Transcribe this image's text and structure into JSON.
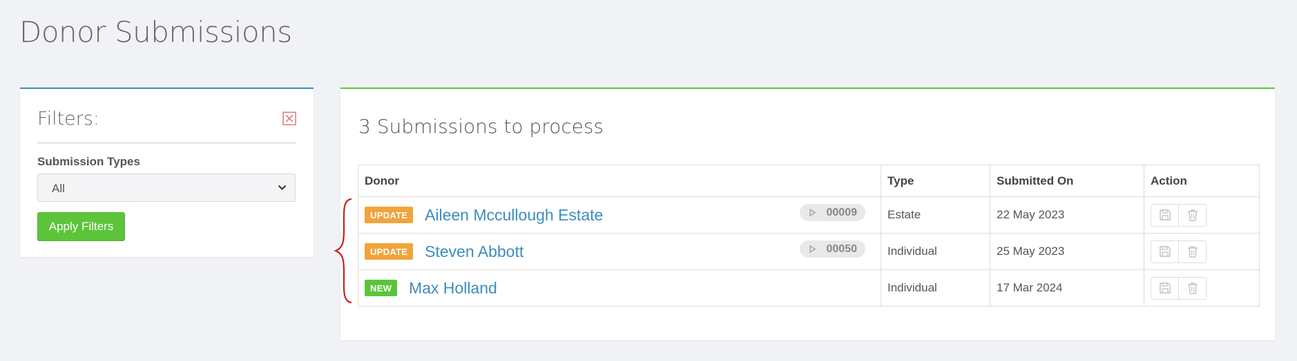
{
  "page": {
    "title": "Donor Submissions"
  },
  "filters": {
    "title": "Filters:",
    "close_icon": "close-icon",
    "submission_types_label": "Submission Types",
    "submission_types_value": "All",
    "apply_label": "Apply Filters"
  },
  "submissions": {
    "heading": "3 Submissions to process",
    "columns": [
      "Donor",
      "Type",
      "Submitted On",
      "Action"
    ],
    "rows": [
      {
        "badge": "UPDATE",
        "badge_color": "#f0a43b",
        "donor": "Aileen Mccullough Estate",
        "donor_id": "00009",
        "type": "Estate",
        "submitted_on": "22 May 2023"
      },
      {
        "badge": "UPDATE",
        "badge_color": "#f0a43b",
        "donor": "Steven Abbott",
        "donor_id": "00050",
        "type": "Individual",
        "submitted_on": "25 May 2023"
      },
      {
        "badge": "NEW",
        "badge_color": "#5cc43a",
        "donor": "Max Holland",
        "donor_id": "",
        "type": "Individual",
        "submitted_on": "17 Mar 2024"
      }
    ],
    "action_icons": [
      "save-icon",
      "trash-icon"
    ]
  },
  "colors": {
    "primary_blue": "#3c8dbc",
    "success_green": "#5cc43a",
    "warning_orange": "#f0a43b",
    "annotation_red": "#cc1f1f"
  }
}
